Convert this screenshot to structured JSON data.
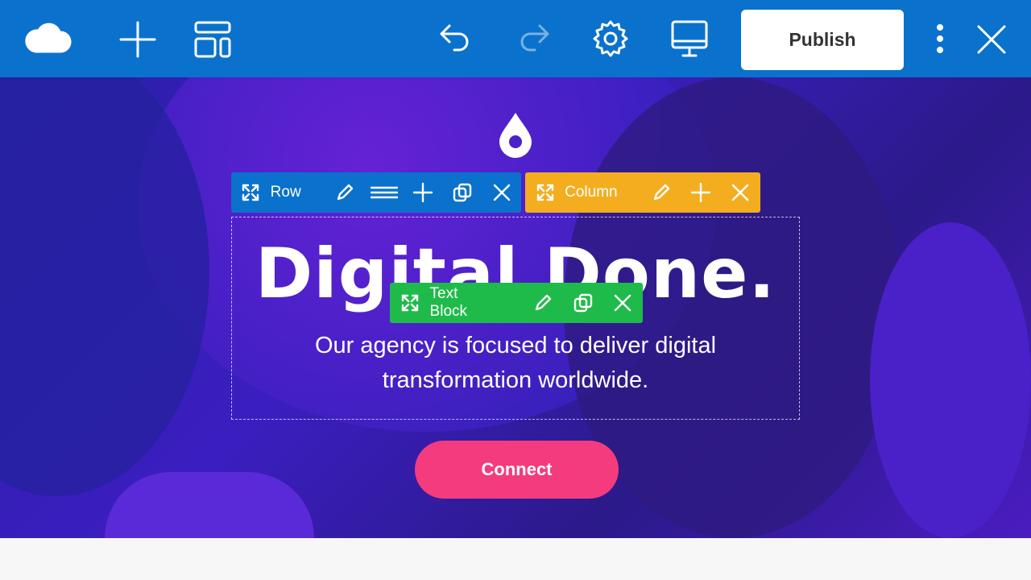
{
  "toolbar": {
    "publish_label": "Publish",
    "icons": [
      "cloud-icon",
      "plus-icon",
      "layout-icon",
      "undo-icon",
      "redo-icon",
      "gear-icon",
      "desktop-icon",
      "more-icon",
      "close-icon"
    ],
    "color": "#0a72cc"
  },
  "controls": {
    "row_label": "Row",
    "column_label": "Column",
    "text_block_label": "Text Block",
    "row_color": "#0a72cc",
    "column_color": "#f4ad1f",
    "text_color": "#1fbb4a"
  },
  "hero": {
    "title": "Digital Done.",
    "subtitle_line1": "Our agency is focused to deliver digital",
    "subtitle_line2": "transformation worldwide.",
    "button_label": "Connect"
  }
}
